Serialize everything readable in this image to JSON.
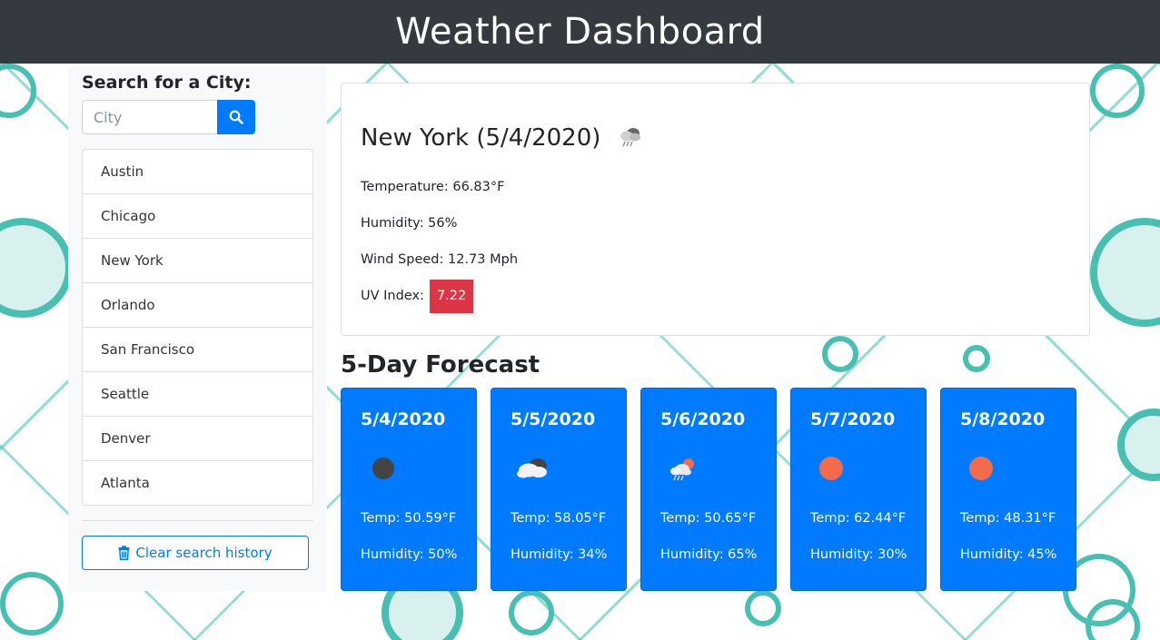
{
  "header": {
    "title": "Weather Dashboard"
  },
  "search": {
    "heading": "Search for a City:",
    "placeholder": "City"
  },
  "history": [
    "Austin",
    "Chicago",
    "New York",
    "Orlando",
    "San Francisco",
    "Seattle",
    "Denver",
    "Atlanta"
  ],
  "clear_label": "Clear search history",
  "current": {
    "title": "New York (5/4/2020)",
    "icon": "rain-cloud-icon",
    "temperature": "Temperature: 66.83°F",
    "humidity": "Humidity: 56%",
    "wind": "Wind Speed: 12.73 Mph",
    "uv_label": "UV Index:",
    "uv_value": "7.22",
    "uv_color": "#dc3545"
  },
  "forecast": {
    "title": "5-Day Forecast",
    "days": [
      {
        "date": "5/4/2020",
        "icon": "night-clear-icon",
        "temp": "Temp: 50.59°F",
        "humidity": "Humidity: 50%"
      },
      {
        "date": "5/5/2020",
        "icon": "broken-clouds-icon",
        "temp": "Temp: 58.05°F",
        "humidity": "Humidity: 34%"
      },
      {
        "date": "5/6/2020",
        "icon": "rain-sun-icon",
        "temp": "Temp: 50.65°F",
        "humidity": "Humidity: 65%"
      },
      {
        "date": "5/7/2020",
        "icon": "clear-sun-icon",
        "temp": "Temp: 62.44°F",
        "humidity": "Humidity: 30%"
      },
      {
        "date": "5/8/2020",
        "icon": "clear-sun-icon",
        "temp": "Temp: 48.31°F",
        "humidity": "Humidity: 45%"
      }
    ]
  },
  "colors": {
    "header_bg": "#343a40",
    "primary": "#007bff",
    "uv_high": "#dc3545",
    "pattern": "#47bfb1"
  }
}
